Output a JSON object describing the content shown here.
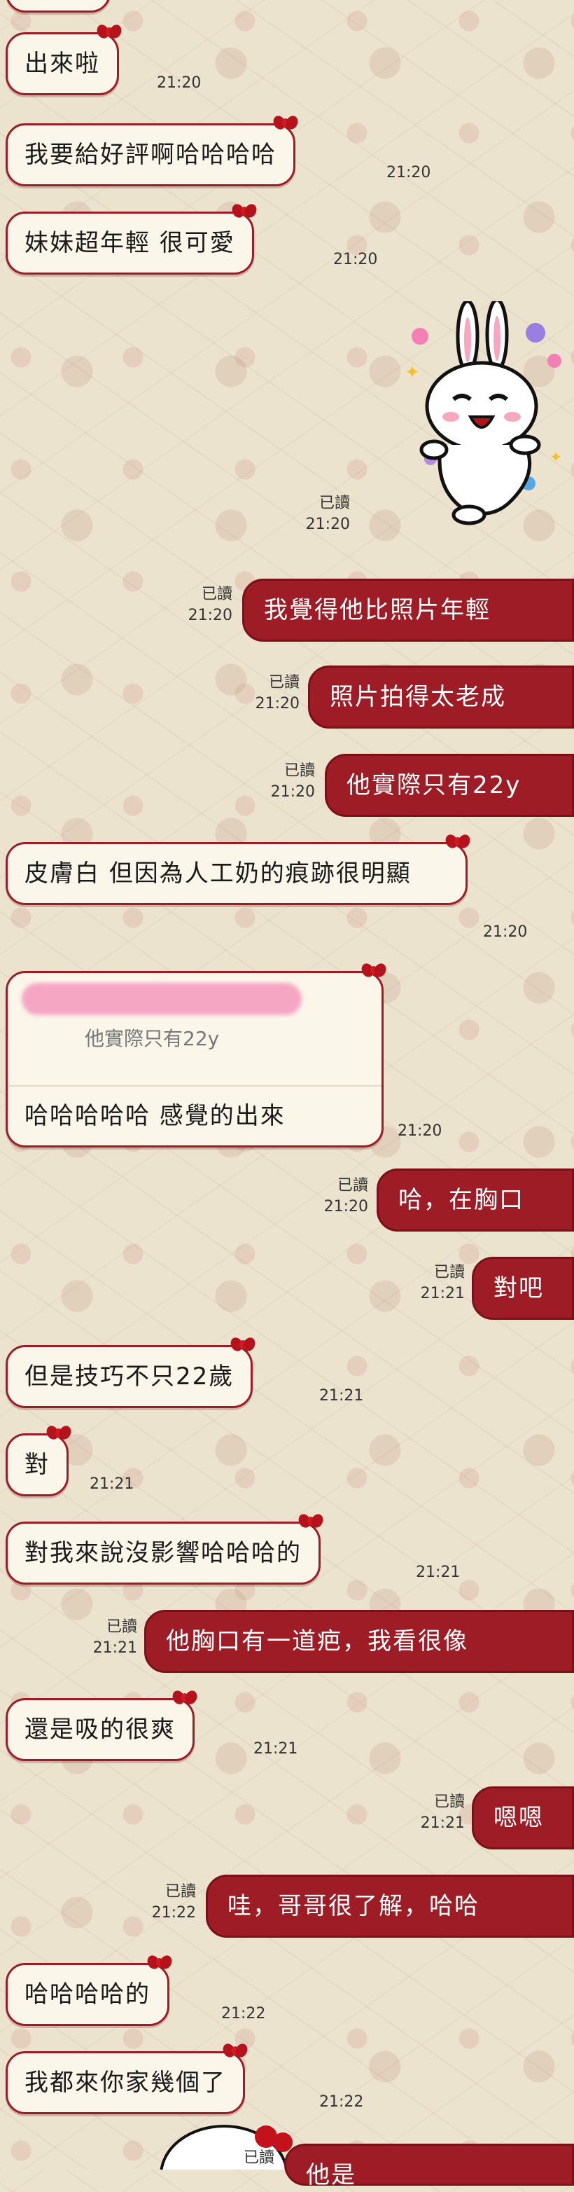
{
  "messages": [
    {
      "text": "出來啦",
      "time": "21:20"
    },
    {
      "text": "我要給好評啊哈哈哈哈",
      "time": "21:20"
    },
    {
      "text": "妹妹超年輕 很可愛",
      "time": "21:20"
    },
    {
      "read": "已讀",
      "time": "21:20",
      "sticker": "smiling-rabbit-sticker"
    },
    {
      "text": "我覺得他比照片年輕",
      "read": "已讀",
      "time": "21:20"
    },
    {
      "text": "照片拍得太老成",
      "read": "已讀",
      "time": "21:20"
    },
    {
      "text": "他實際只有22y",
      "read": "已讀",
      "time": "21:20"
    },
    {
      "text": "皮膚白 但因為人工奶的痕跡很明顯",
      "time": "21:20"
    },
    {
      "quote": "他實際只有22y",
      "text": "哈哈哈哈哈 感覺的出來",
      "time": "21:20"
    },
    {
      "text": "哈，在胸口",
      "read": "已讀",
      "time": "21:20"
    },
    {
      "text": "對吧",
      "read": "已讀",
      "time": "21:21"
    },
    {
      "text": "但是技巧不只22歲",
      "time": "21:21"
    },
    {
      "text": "對",
      "time": "21:21"
    },
    {
      "text": "對我來說沒影響哈哈哈的",
      "time": "21:21"
    },
    {
      "text": "他胸口有一道疤，我看很像",
      "read": "已讀",
      "time": "21:21"
    },
    {
      "text": "還是吸的很爽",
      "time": "21:21"
    },
    {
      "text": "嗯嗯",
      "read": "已讀",
      "time": "21:21"
    },
    {
      "text": "哇，哥哥很了解，哈哈",
      "read": "已讀",
      "time": "21:22"
    },
    {
      "text": "哈哈哈哈的",
      "time": "21:22"
    },
    {
      "text": "我都來你家幾個了",
      "time": "21:22"
    },
    {
      "text": "他是",
      "read": "已讀"
    }
  ],
  "colors": {
    "outgoing": "#9e1c26",
    "incoming": "#fbf6ea",
    "bow": "#b5121b"
  }
}
